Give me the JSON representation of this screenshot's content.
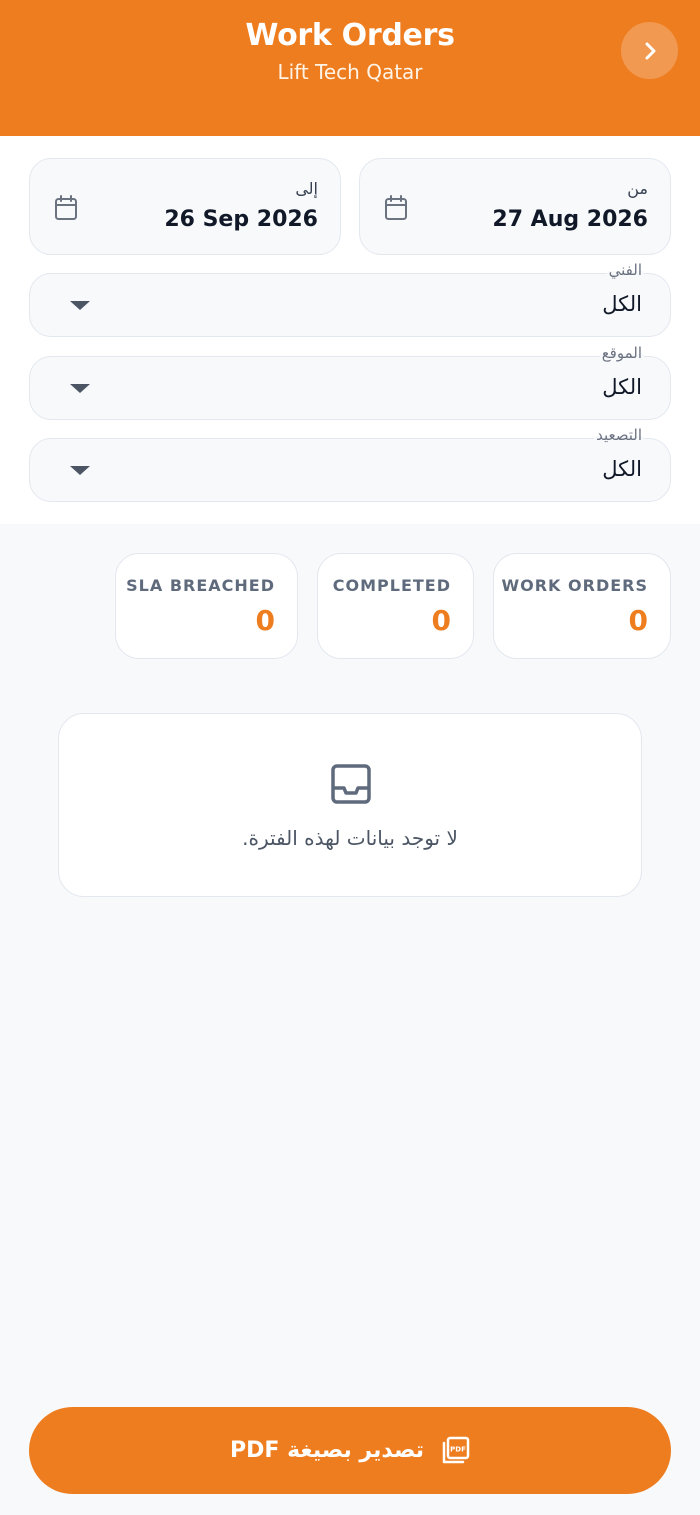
{
  "header": {
    "title": "Work Orders",
    "subtitle": "Lift Tech Qatar",
    "back_icon": "chevron-right-icon"
  },
  "filters": {
    "from": {
      "label": "من",
      "value": "27 Aug 2026",
      "icon": "calendar-icon"
    },
    "to": {
      "label": "إلى",
      "value": "26 Sep 2026",
      "icon": "calendar-icon"
    },
    "technician": {
      "label": "الفني",
      "value": "الكل"
    },
    "location": {
      "label": "الموقع",
      "value": "الكل"
    },
    "escalation": {
      "label": "التصعيد",
      "value": "الكل"
    }
  },
  "stats": [
    {
      "label": "WORK ORDERS",
      "value": "0"
    },
    {
      "label": "COMPLETED",
      "value": "0"
    },
    {
      "label": "SLA BREACHED",
      "value": "0"
    }
  ],
  "empty_state": {
    "icon": "inbox-icon",
    "message": "لا توجد بيانات لهذه الفترة."
  },
  "export": {
    "label": "تصدير بصيغة PDF",
    "icon": "pdf-icon"
  },
  "colors": {
    "accent": "#ee7d1f",
    "background": "#f7f9fb",
    "border": "#e3e8ef"
  }
}
